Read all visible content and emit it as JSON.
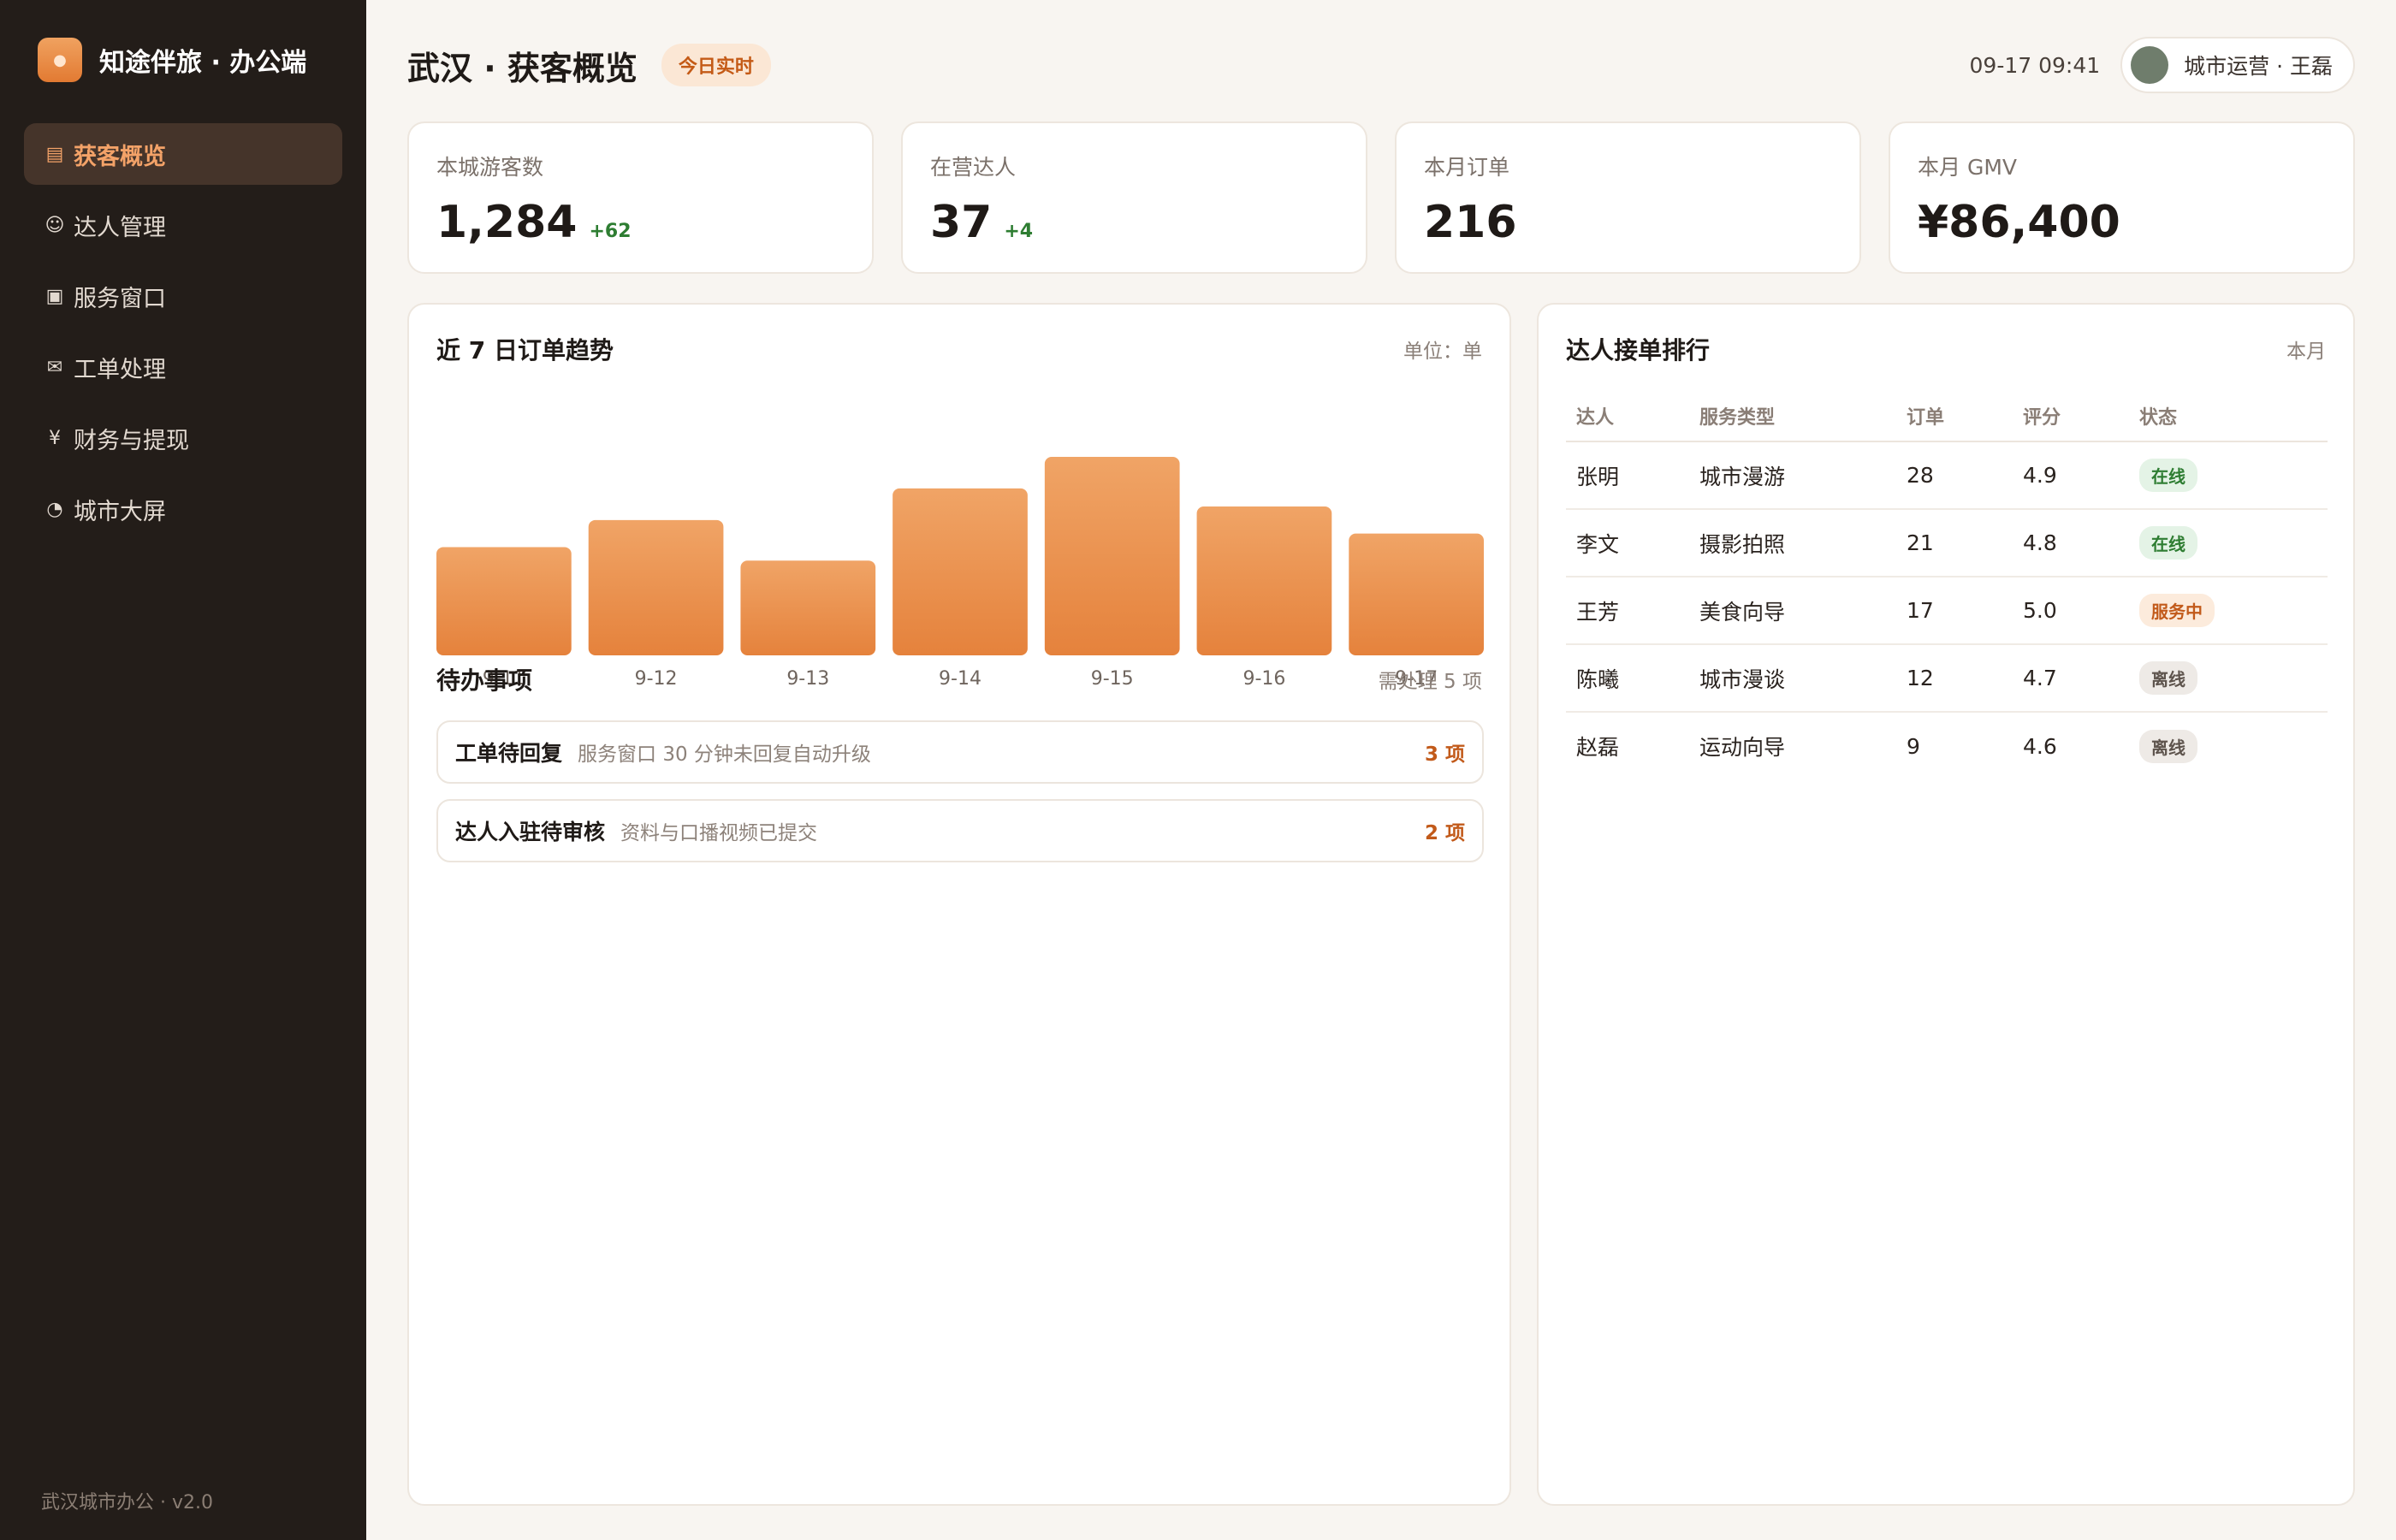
{
  "brand": {
    "title": "知途伴旅 · 办公端",
    "logo_icon": "sun-icon"
  },
  "sidebar": {
    "items": [
      {
        "label": "获客概览",
        "icon": "▤",
        "active": true
      },
      {
        "label": "达人管理",
        "icon": "☺",
        "active": false
      },
      {
        "label": "服务窗口",
        "icon": "▣",
        "active": false
      },
      {
        "label": "工单处理",
        "icon": "✉",
        "active": false
      },
      {
        "label": "财务与提现",
        "icon": "¥",
        "active": false
      },
      {
        "label": "城市大屏",
        "icon": "◔",
        "active": false
      }
    ],
    "footer": "武汉城市办公 · v2.0"
  },
  "header": {
    "title": "武汉 · 获客概览",
    "badge": "今日实时",
    "time": "09-17 09:41",
    "user": "城市运营 · 王磊"
  },
  "kpis": [
    {
      "label": "本城游客数",
      "value": "1,284",
      "delta": "+62"
    },
    {
      "label": "在营达人",
      "value": "37",
      "delta": "+4"
    },
    {
      "label": "本月订单",
      "value": "216",
      "delta": ""
    },
    {
      "label": "本月 GMV",
      "value": "¥86,400",
      "delta": ""
    }
  ],
  "trend": {
    "title": "近 7 日订单趋势",
    "unit": "单位：单"
  },
  "chart_data": {
    "type": "bar",
    "categories": [
      "9-11",
      "9-12",
      "9-13",
      "9-14",
      "9-15",
      "9-16",
      "9-17"
    ],
    "values": [
      24,
      30,
      21,
      37,
      44,
      33,
      27
    ],
    "ylim": [
      0,
      44
    ],
    "grid": false,
    "color": "#e8853f"
  },
  "todos": {
    "title": "待办事项",
    "summary": "需处理 5 项",
    "items": [
      {
        "title": "工单待回复",
        "desc": "服务窗口 30 分钟未回复自动升级",
        "count": "3 项"
      },
      {
        "title": "达人入驻待审核",
        "desc": "资料与口播视频已提交",
        "count": "2 项"
      }
    ]
  },
  "ranking": {
    "title": "达人接单排行",
    "period": "本月",
    "columns": [
      "达人",
      "服务类型",
      "订单",
      "评分",
      "状态"
    ],
    "rows": [
      {
        "name": "张明",
        "type": "城市漫游",
        "orders": "28",
        "rating": "4.9",
        "status": "在线",
        "status_kind": "online"
      },
      {
        "name": "李文",
        "type": "摄影拍照",
        "orders": "21",
        "rating": "4.8",
        "status": "在线",
        "status_kind": "online"
      },
      {
        "name": "王芳",
        "type": "美食向导",
        "orders": "17",
        "rating": "5.0",
        "status": "服务中",
        "status_kind": "busy"
      },
      {
        "name": "陈曦",
        "type": "城市漫谈",
        "orders": "12",
        "rating": "4.7",
        "status": "离线",
        "status_kind": "offline"
      },
      {
        "name": "赵磊",
        "type": "运动向导",
        "orders": "9",
        "rating": "4.6",
        "status": "离线",
        "status_kind": "offline"
      }
    ]
  }
}
